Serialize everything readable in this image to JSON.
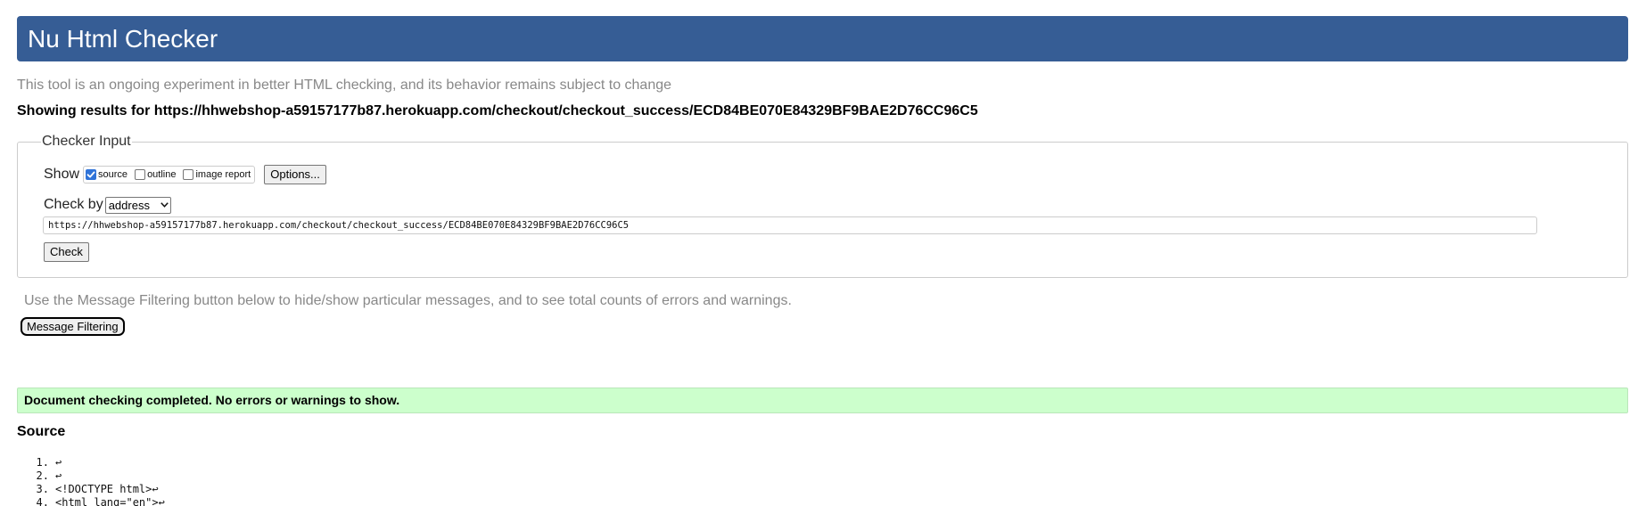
{
  "header": {
    "title": "Nu Html Checker"
  },
  "notice": "This tool is an ongoing experiment in better HTML checking, and its behavior remains subject to change",
  "results_for": "Showing results for https://hhwebshop-a59157177b87.herokuapp.com/checkout/checkout_success/ECD84BE070E84329BF9BAE2D76CC96C5",
  "checker_input": {
    "legend": "Checker Input",
    "show_label": "Show",
    "show_options": [
      {
        "label": "source",
        "checked": true
      },
      {
        "label": "outline",
        "checked": false
      },
      {
        "label": "image report",
        "checked": false
      }
    ],
    "options_button": "Options...",
    "check_by_label": "Check by",
    "check_by_selected": "address",
    "url_value": "https://hhwebshop-a59157177b87.herokuapp.com/checkout/checkout_success/ECD84BE070E84329BF9BAE2D76CC96C5",
    "check_button": "Check"
  },
  "filter_hint": "Use the Message Filtering button below to hide/show particular messages, and to see total counts of errors and warnings.",
  "filter_button": "Message Filtering",
  "success_message": "Document checking completed. No errors or warnings to show.",
  "source": {
    "heading": "Source",
    "lines": [
      {
        "num": "1.",
        "code": "↩"
      },
      {
        "num": "2.",
        "code": "↩"
      },
      {
        "num": "3.",
        "code": "<!DOCTYPE html>↩"
      },
      {
        "num": "4.",
        "code": "<html lang=\"en\">↩"
      }
    ]
  },
  "colors": {
    "header_bg": "#365d95",
    "success_bg": "#ccffcc",
    "checkbox_checked": "#2f73d8"
  }
}
